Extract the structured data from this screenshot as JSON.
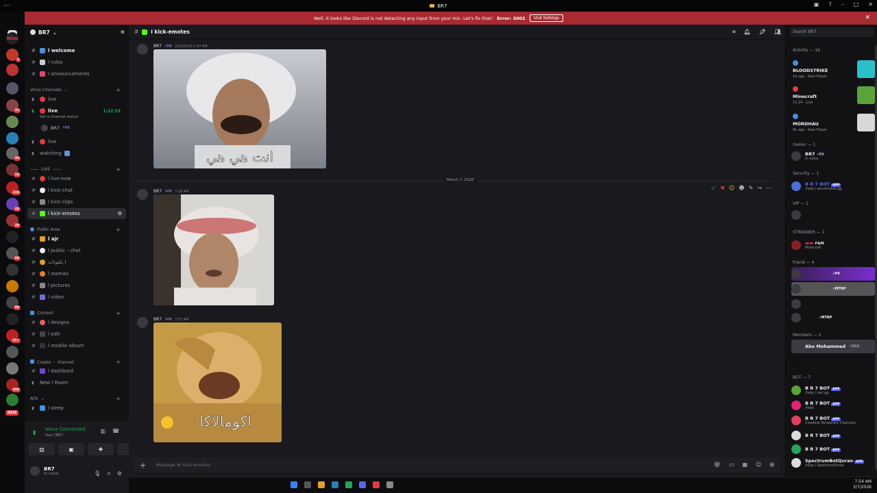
{
  "window": {
    "title": "BR7"
  },
  "notice": {
    "text": "Well, it looks like Discord is not detecting any input from your mic. Let's fix that!",
    "error": "Error: 3002",
    "button": "Visit Settings"
  },
  "server": {
    "name": "BR7"
  },
  "channels_top": [
    {
      "name": "ا welcome"
    },
    {
      "name": "ا rules"
    },
    {
      "name": "ا announcements"
    }
  ],
  "voice_category": "Voice Channels",
  "voice": {
    "live1": "live",
    "live2": "live",
    "timer": "1:22:33",
    "status_hint": "Set a channel status",
    "voice_user": "BR7",
    "voice_user_tag": "⚡PX",
    "live3": "live",
    "watching": "watching"
  },
  "live_category": "LIVE",
  "live_channels": [
    {
      "name": "ا live-now"
    },
    {
      "name": "ا kick-chat"
    },
    {
      "name": "ا kick-clips"
    },
    {
      "name": "ا kick-emotes"
    }
  ],
  "public_category": "Public Area",
  "public_channels": [
    {
      "name": "ا ajr"
    },
    {
      "name": "ا public・chat"
    },
    {
      "name": "ا نكتوتات"
    },
    {
      "name": "ا memes"
    },
    {
      "name": "ا pictures"
    },
    {
      "name": "ا video"
    }
  ],
  "content_category": "Content",
  "content_channels": [
    {
      "name": "ا designs"
    },
    {
      "name": "ا edit"
    },
    {
      "name": "ا mobile-album"
    }
  ],
  "create_category": "Create ・ channel",
  "create_channels": [
    {
      "name": "ا dashbord"
    },
    {
      "name": "New ا Room"
    }
  ],
  "afk_category": "AFK",
  "afk_channels": [
    {
      "name": "ا sleep"
    }
  ],
  "voice_panel": {
    "title": "Voice Connected",
    "sub": "live / BR7",
    "me_name": "BR7",
    "me_status": "In voice"
  },
  "rail": {
    "new_label": "NEW",
    "top_text": "NGm"
  },
  "chat": {
    "channel": "ا kick-emotes",
    "messages": [
      {
        "author": "BR7",
        "tag": "⚡PX",
        "time": "2/14/2026 1:47 AM",
        "gif_caption": "انت هي هي"
      },
      {
        "author": "BR7",
        "tag": "⚡PX",
        "time": "7:29 AM"
      },
      {
        "author": "BR7",
        "tag": "⚡PX",
        "time": "7:52 AM",
        "gif_caption": "اكومالاكا"
      }
    ],
    "date_divider": "March 7, 2026",
    "composer_placeholder": "Message #ا kick-emotes"
  },
  "members": {
    "search_placeholder": "Search BR7",
    "activity_header": "Activity — 16",
    "activities": [
      {
        "game": "BLOODSTRIKE",
        "detail": "1d ago · New Player",
        "color": "#2bc0c9"
      },
      {
        "game": "Minecraft",
        "detail": "11:24 · Live",
        "color": "#5aa33a"
      },
      {
        "game": "MORDHAU",
        "detail": "9h ago · New Player",
        "color": "#d8d8d8"
      }
    ],
    "owner_header": "Owner — 1",
    "owner": {
      "name": "BR7",
      "tag": "⚡PX",
      "status": "In voice"
    },
    "security_header": "Security — 1",
    "security": {
      "name": "B R 7 BOT",
      "status": "/help | securitybot.gg"
    },
    "vip_header": "VIP — 1",
    "streamer_header": "STREAMER — 1",
    "streamer": {
      "tag": "F&M",
      "status": "Minecraft"
    },
    "friend_header": "friend — 4",
    "friends": [
      {
        "tag": "⚡PX"
      },
      {
        "tag": "⚡MTRP"
      },
      {
        "tag": ""
      },
      {
        "tag": "⚡MTRP"
      }
    ],
    "members_header": "Members — 2",
    "members_list": [
      {
        "name": "Abo Mohammed",
        "tag": "⚡OLD"
      },
      {
        "name": ""
      }
    ],
    "bot_header": "BOT — 7",
    "bots": [
      {
        "name": "B R 7 BOT",
        "status": "/help | carl.gg",
        "color": "#5aa33a"
      },
      {
        "name": "B R 7 BOT",
        "status": "/help",
        "color": "#e0247a"
      },
      {
        "name": "B R 7 BOT",
        "status": "Creating Temporary Channels",
        "color": "#e04060"
      },
      {
        "name": "B R 7 BOT",
        "status": "",
        "color": "#dddddd"
      },
      {
        "name": "B R 7 BOT",
        "status": "",
        "color": "#23a55a"
      },
      {
        "name": "SpectrumBotQuran",
        "status": "/help | SpectrumQuran",
        "color": "#dddddd"
      }
    ],
    "app_label": "APP"
  },
  "taskbar": {
    "time": "7:54 AM",
    "date": "3/7/2026"
  }
}
